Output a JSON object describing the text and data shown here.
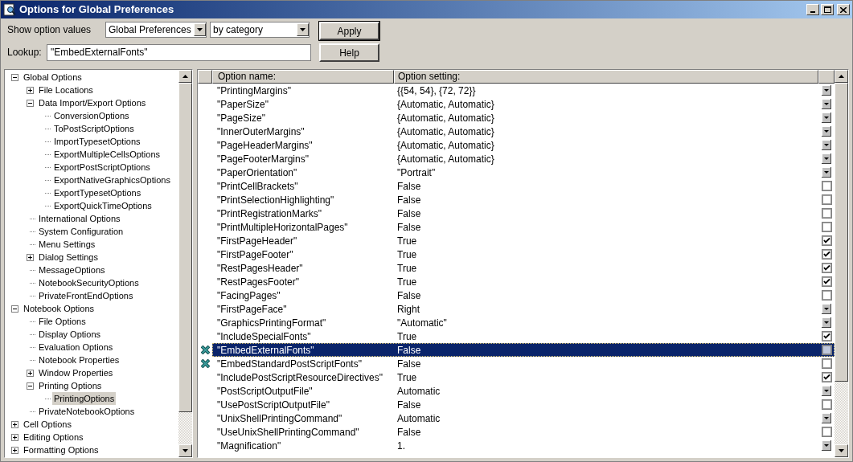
{
  "window": {
    "title": "Options for Global Preferences"
  },
  "toolbar": {
    "show_label": "Show option values",
    "scope": "Global Preferences",
    "grouping": "by category",
    "lookup_label": "Lookup:",
    "lookup_value": "\"EmbedExternalFonts\"",
    "buttons": [
      "Apply",
      "Help"
    ]
  },
  "tree": [
    {
      "label": "Global Options",
      "expanded": true,
      "selected": false,
      "children": [
        {
          "label": "File Locations",
          "expanded": false,
          "selected": false
        },
        {
          "label": "Data Import/Export Options",
          "expanded": true,
          "selected": false,
          "children": [
            {
              "label": "ConversionOptions",
              "selected": false
            },
            {
              "label": "ToPostScriptOptions",
              "selected": false
            },
            {
              "label": "ImportTypesetOptions",
              "selected": false
            },
            {
              "label": "ExportMultipleCellsOptions",
              "selected": false
            },
            {
              "label": "ExportPostScriptOptions",
              "selected": false
            },
            {
              "label": "ExportNativeGraphicsOptions",
              "selected": false
            },
            {
              "label": "ExportTypesetOptions",
              "selected": false
            },
            {
              "label": "ExportQuickTimeOptions",
              "selected": false
            }
          ]
        },
        {
          "label": "International Options",
          "selected": false
        },
        {
          "label": "System Configuration",
          "selected": false
        },
        {
          "label": "Menu Settings",
          "selected": false
        },
        {
          "label": "Dialog Settings",
          "expanded": false,
          "selected": false
        },
        {
          "label": "MessageOptions",
          "selected": false
        },
        {
          "label": "NotebookSecurityOptions",
          "selected": false
        },
        {
          "label": "PrivateFrontEndOptions",
          "selected": false
        }
      ]
    },
    {
      "label": "Notebook Options",
      "expanded": true,
      "selected": false,
      "children": [
        {
          "label": "File Options",
          "selected": false
        },
        {
          "label": "Display Options",
          "selected": false
        },
        {
          "label": "Evaluation Options",
          "selected": false
        },
        {
          "label": "Notebook Properties",
          "selected": false
        },
        {
          "label": "Window Properties",
          "expanded": false,
          "selected": false
        },
        {
          "label": "Printing Options",
          "expanded": true,
          "selected": false,
          "children": [
            {
              "label": "PrintingOptions",
              "selected": true
            }
          ]
        },
        {
          "label": "PrivateNotebookOptions",
          "selected": false
        }
      ]
    },
    {
      "label": "Cell Options",
      "expanded": false,
      "selected": false
    },
    {
      "label": "Editing Options",
      "expanded": false,
      "selected": false
    },
    {
      "label": "Formatting Options",
      "expanded": false,
      "selected": false
    }
  ],
  "table": {
    "columns": [
      "Option name:",
      "Option setting:"
    ],
    "rows": [
      {
        "name": "\"PrintingMargins\"",
        "setting": "{{54, 54}, {72, 72}}",
        "kind": "dropdown",
        "modified": false,
        "selected": false
      },
      {
        "name": "\"PaperSize\"",
        "setting": "{Automatic, Automatic}",
        "kind": "dropdown",
        "modified": false,
        "selected": false
      },
      {
        "name": "\"PageSize\"",
        "setting": "{Automatic, Automatic}",
        "kind": "dropdown",
        "modified": false,
        "selected": false
      },
      {
        "name": "\"InnerOuterMargins\"",
        "setting": "{Automatic, Automatic}",
        "kind": "dropdown",
        "modified": false,
        "selected": false
      },
      {
        "name": "\"PageHeaderMargins\"",
        "setting": "{Automatic, Automatic}",
        "kind": "dropdown",
        "modified": false,
        "selected": false
      },
      {
        "name": "\"PageFooterMargins\"",
        "setting": "{Automatic, Automatic}",
        "kind": "dropdown",
        "modified": false,
        "selected": false
      },
      {
        "name": "\"PaperOrientation\"",
        "setting": "\"Portrait\"",
        "kind": "dropdown",
        "modified": false,
        "selected": false
      },
      {
        "name": "\"PrintCellBrackets\"",
        "setting": "False",
        "kind": "checkbox",
        "checked": false,
        "modified": false,
        "selected": false
      },
      {
        "name": "\"PrintSelectionHighlighting\"",
        "setting": "False",
        "kind": "checkbox",
        "checked": false,
        "modified": false,
        "selected": false
      },
      {
        "name": "\"PrintRegistrationMarks\"",
        "setting": "False",
        "kind": "checkbox",
        "checked": false,
        "modified": false,
        "selected": false
      },
      {
        "name": "\"PrintMultipleHorizontalPages\"",
        "setting": "False",
        "kind": "checkbox",
        "checked": false,
        "modified": false,
        "selected": false
      },
      {
        "name": "\"FirstPageHeader\"",
        "setting": "True",
        "kind": "checkbox",
        "checked": true,
        "modified": false,
        "selected": false
      },
      {
        "name": "\"FirstPageFooter\"",
        "setting": "True",
        "kind": "checkbox",
        "checked": true,
        "modified": false,
        "selected": false
      },
      {
        "name": "\"RestPagesHeader\"",
        "setting": "True",
        "kind": "checkbox",
        "checked": true,
        "modified": false,
        "selected": false
      },
      {
        "name": "\"RestPagesFooter\"",
        "setting": "True",
        "kind": "checkbox",
        "checked": true,
        "modified": false,
        "selected": false
      },
      {
        "name": "\"FacingPages\"",
        "setting": "False",
        "kind": "checkbox",
        "checked": false,
        "modified": false,
        "selected": false
      },
      {
        "name": "\"FirstPageFace\"",
        "setting": "Right",
        "kind": "dropdown",
        "modified": false,
        "selected": false
      },
      {
        "name": "\"GraphicsPrintingFormat\"",
        "setting": "\"Automatic\"",
        "kind": "dropdown",
        "modified": false,
        "selected": false
      },
      {
        "name": "\"IncludeSpecialFonts\"",
        "setting": "True",
        "kind": "checkbox",
        "checked": true,
        "modified": false,
        "selected": false
      },
      {
        "name": "\"EmbedExternalFonts\"",
        "setting": "False",
        "kind": "checkbox",
        "checked": false,
        "modified": true,
        "selected": true
      },
      {
        "name": "\"EmbedStandardPostScriptFonts\"",
        "setting": "False",
        "kind": "checkbox",
        "checked": false,
        "modified": true,
        "selected": false
      },
      {
        "name": "\"IncludePostScriptResourceDirectives\"",
        "setting": "True",
        "kind": "checkbox",
        "checked": true,
        "modified": false,
        "selected": false
      },
      {
        "name": "\"PostScriptOutputFile\"",
        "setting": "Automatic",
        "kind": "dropdown",
        "modified": false,
        "selected": false
      },
      {
        "name": "\"UsePostScriptOutputFile\"",
        "setting": "False",
        "kind": "checkbox",
        "checked": false,
        "modified": false,
        "selected": false
      },
      {
        "name": "\"UnixShellPrintingCommand\"",
        "setting": "Automatic",
        "kind": "dropdown",
        "modified": false,
        "selected": false
      },
      {
        "name": "\"UseUnixShellPrintingCommand\"",
        "setting": "False",
        "kind": "checkbox",
        "checked": false,
        "modified": false,
        "selected": false
      },
      {
        "name": "\"Magnification\"",
        "setting": "1.",
        "kind": "dropdown",
        "modified": false,
        "selected": false
      }
    ]
  }
}
